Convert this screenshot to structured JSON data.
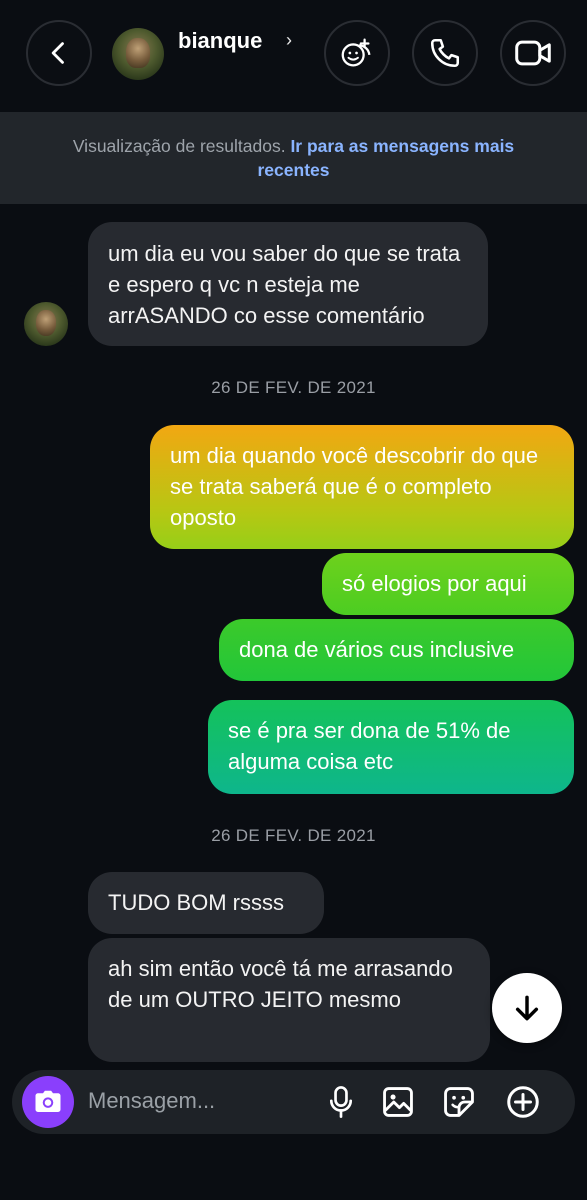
{
  "header": {
    "contact_name": "bianque",
    "name_chevron": "›"
  },
  "banner": {
    "text": "Visualização de resultados.",
    "link": "Ir para as mensagens mais recentes"
  },
  "messages": [
    {
      "side": "received",
      "text": "um dia eu vou saber do que se trata e espero q vc n esteja me arrASANDO co esse comentário"
    },
    {
      "side": "date",
      "text": "26 DE FEV. DE 2021"
    },
    {
      "side": "sent",
      "text": "um dia quando você descobrir do que se trata saberá que é o completo oposto"
    },
    {
      "side": "sent",
      "text": "só elogios por aqui"
    },
    {
      "side": "sent",
      "text": "dona de vários cus inclusive"
    },
    {
      "side": "sent",
      "text": "se é pra ser dona de 51% de alguma coisa etc"
    },
    {
      "side": "date",
      "text": "26 DE FEV. DE 2021"
    },
    {
      "side": "received",
      "text": "TUDO BOM rssss"
    },
    {
      "side": "received",
      "text": "ah sim então você tá me arrasando de um OUTRO JEITO mesmo"
    }
  ],
  "composer": {
    "placeholder": "Mensagem..."
  },
  "icons": {
    "back": "chevron-left-icon",
    "add_people": "add-people-icon",
    "call": "phone-icon",
    "video": "video-camera-icon",
    "camera": "camera-icon",
    "mic": "microphone-icon",
    "gallery": "image-icon",
    "sticker": "sticker-icon",
    "plus": "plus-circle-icon",
    "scroll": "arrow-down-icon"
  },
  "colors": {
    "background": "#0a0d12",
    "received_bubble": "#272a30",
    "sent_gradient_top": "#f2a712",
    "sent_gradient_middle": "#2ec92e",
    "sent_gradient_bottom": "#0eb89a",
    "link": "#8ab4ff",
    "camera_button": "#8a3ffc"
  }
}
